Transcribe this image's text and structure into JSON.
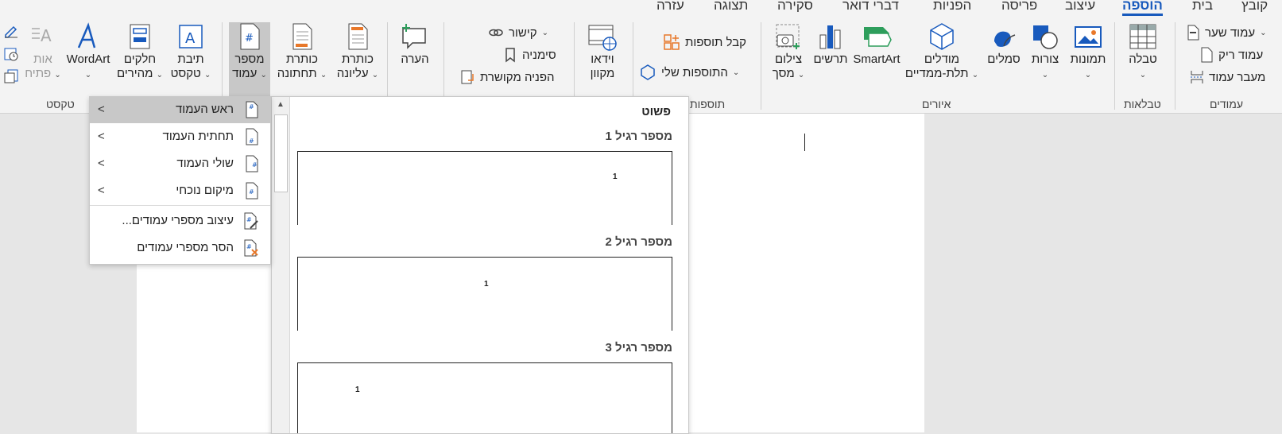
{
  "tabs": [
    {
      "label": "קובץ"
    },
    {
      "label": "בית"
    },
    {
      "label": "הוספה",
      "active": true
    },
    {
      "label": "עיצוב"
    },
    {
      "label": "פריסה"
    },
    {
      "label": "הפניות"
    },
    {
      "label": "דברי דואר"
    },
    {
      "label": "סקירה"
    },
    {
      "label": "תצוגה"
    },
    {
      "label": "עזרה"
    }
  ],
  "ribbon": {
    "pages": {
      "group_label": "עמודים",
      "cover_page": "עמוד שער",
      "blank_page": "עמוד ריק",
      "page_break": "מעבר עמוד"
    },
    "tables": {
      "group_label": "טבלאות",
      "table": "טבלה"
    },
    "illustrations": {
      "group_label": "איורים",
      "pictures": "תמונות",
      "shapes": "צורות",
      "icons": "סמלים",
      "models_line1": "מודלים",
      "models_line2": "תלת-ממדיים",
      "smartart": "SmartArt",
      "chart": "תרשים",
      "screenshot_line1": "צילום",
      "screenshot_line2": "מסך"
    },
    "addins": {
      "group_label": "תוספות",
      "get_addins": "קבל תוספות",
      "my_addins": "התוספות שלי"
    },
    "media": {
      "video_line1": "וידאו",
      "video_line2": "מקוון"
    },
    "links": {
      "link": "קישור",
      "bookmark": "סימניה",
      "cross_ref": "הפניה מקושרת"
    },
    "comments": {
      "comment": "הערה"
    },
    "header_footer": {
      "header_line1": "כותרת",
      "header_line2": "עליונה",
      "footer_line1": "כותרת",
      "footer_line2": "תחתונה",
      "page_number_line1": "מספר",
      "page_number_line2": "עמוד"
    },
    "text": {
      "group_label": "טקסט",
      "textbox_line1": "תיבת",
      "textbox_line2": "טקסט",
      "quickparts_line1": "חלקים",
      "quickparts_line2": "מהירים",
      "wordart": "WordArt",
      "dropcap_line1": "אות",
      "dropcap_line2": "פתיח"
    }
  },
  "gallery": {
    "header": "פשוט",
    "items": [
      {
        "title": "מספר רגיל 1",
        "number": "1"
      },
      {
        "title": "מספר רגיל 2",
        "number": "1"
      },
      {
        "title": "מספר רגיל 3",
        "number": "1"
      }
    ]
  },
  "menu": {
    "items": [
      {
        "label": "ראש העמוד"
      },
      {
        "label": "תחתית העמוד"
      },
      {
        "label": "שולי העמוד"
      },
      {
        "label": "מיקום נוכחי"
      },
      {
        "label": "עיצוב מספרי עמודים..."
      },
      {
        "label": "הסר מספרי עמודים"
      }
    ]
  },
  "colors": {
    "accent": "#185abd",
    "highlight": "#c8c8c8",
    "ribbon_bg": "#f3f3f3"
  }
}
